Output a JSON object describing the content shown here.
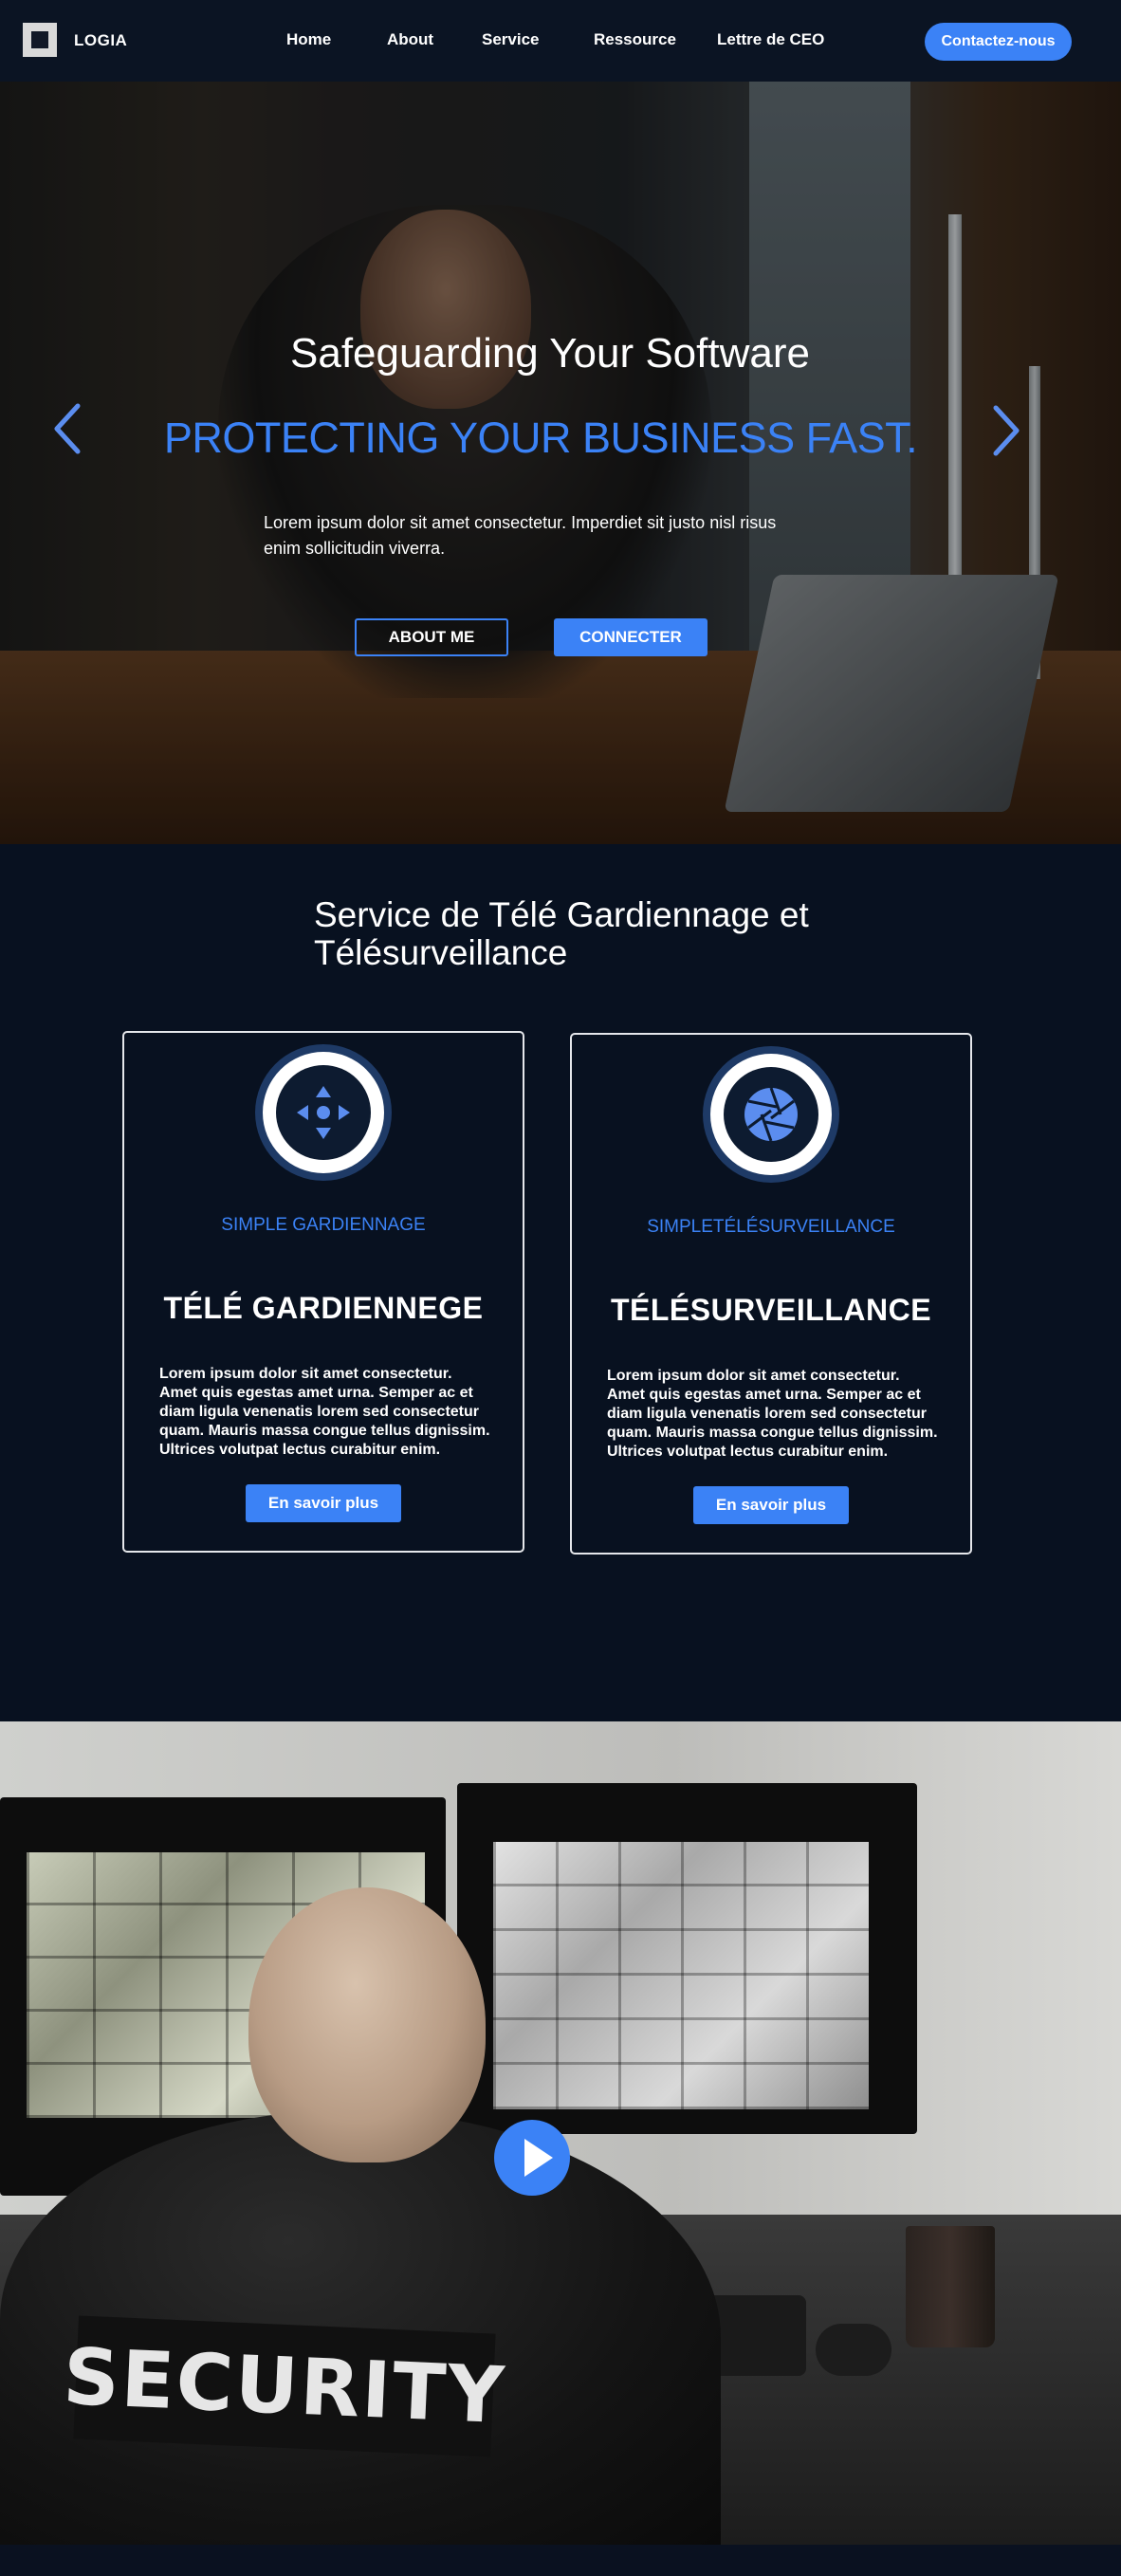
{
  "nav": {
    "logo": "LOGIA",
    "links": [
      "Home",
      "About",
      "Service",
      "Ressource",
      "Lettre de CEO"
    ],
    "cta": "Contactez-nous"
  },
  "hero": {
    "title": "Safeguarding Your Software",
    "subtitle": "PROTECTING YOUR BUSINESS FAST.",
    "text": "Lorem ipsum dolor sit amet consectetur. Imperdiet sit justo nisl risus enim sollicitudin viverra.",
    "button_about": "ABOUT ME",
    "button_connect": "CONNECTER"
  },
  "services": {
    "title": "Service de Télé Gardiennage et Télésurveillance",
    "cards": [
      {
        "kicker": "SIMPLE GARDIENNAGE",
        "heading": "TÉLÉ GARDIENNEGE",
        "text": "Lorem ipsum dolor sit amet consectetur. Amet quis egestas amet urna. Semper ac et diam ligula venenatis lorem sed consectetur quam. Mauris massa congue tellus dignissim. Ultrices volutpat lectus curabitur enim.",
        "button": "En savoir plus",
        "icon": "move-arrows-icon"
      },
      {
        "kicker": "SIMPLETÉLÉSURVEILLANCE",
        "heading": "TÉLÉSURVEILLANCE",
        "text": "Lorem ipsum dolor sit amet consectetur. Amet quis egestas amet urna. Semper ac et diam ligula venenatis lorem sed consectetur quam. Mauris massa congue tellus dignissim. Ultrices volutpat lectus curabitur enim.",
        "button": "En savoir plus",
        "icon": "camera-aperture-icon"
      }
    ]
  },
  "video": {
    "patch_text": "SECURITY",
    "play_icon": "play-icon"
  },
  "colors": {
    "accent": "#3b82f6",
    "background": "#081120",
    "navbar": "#0b1423"
  }
}
